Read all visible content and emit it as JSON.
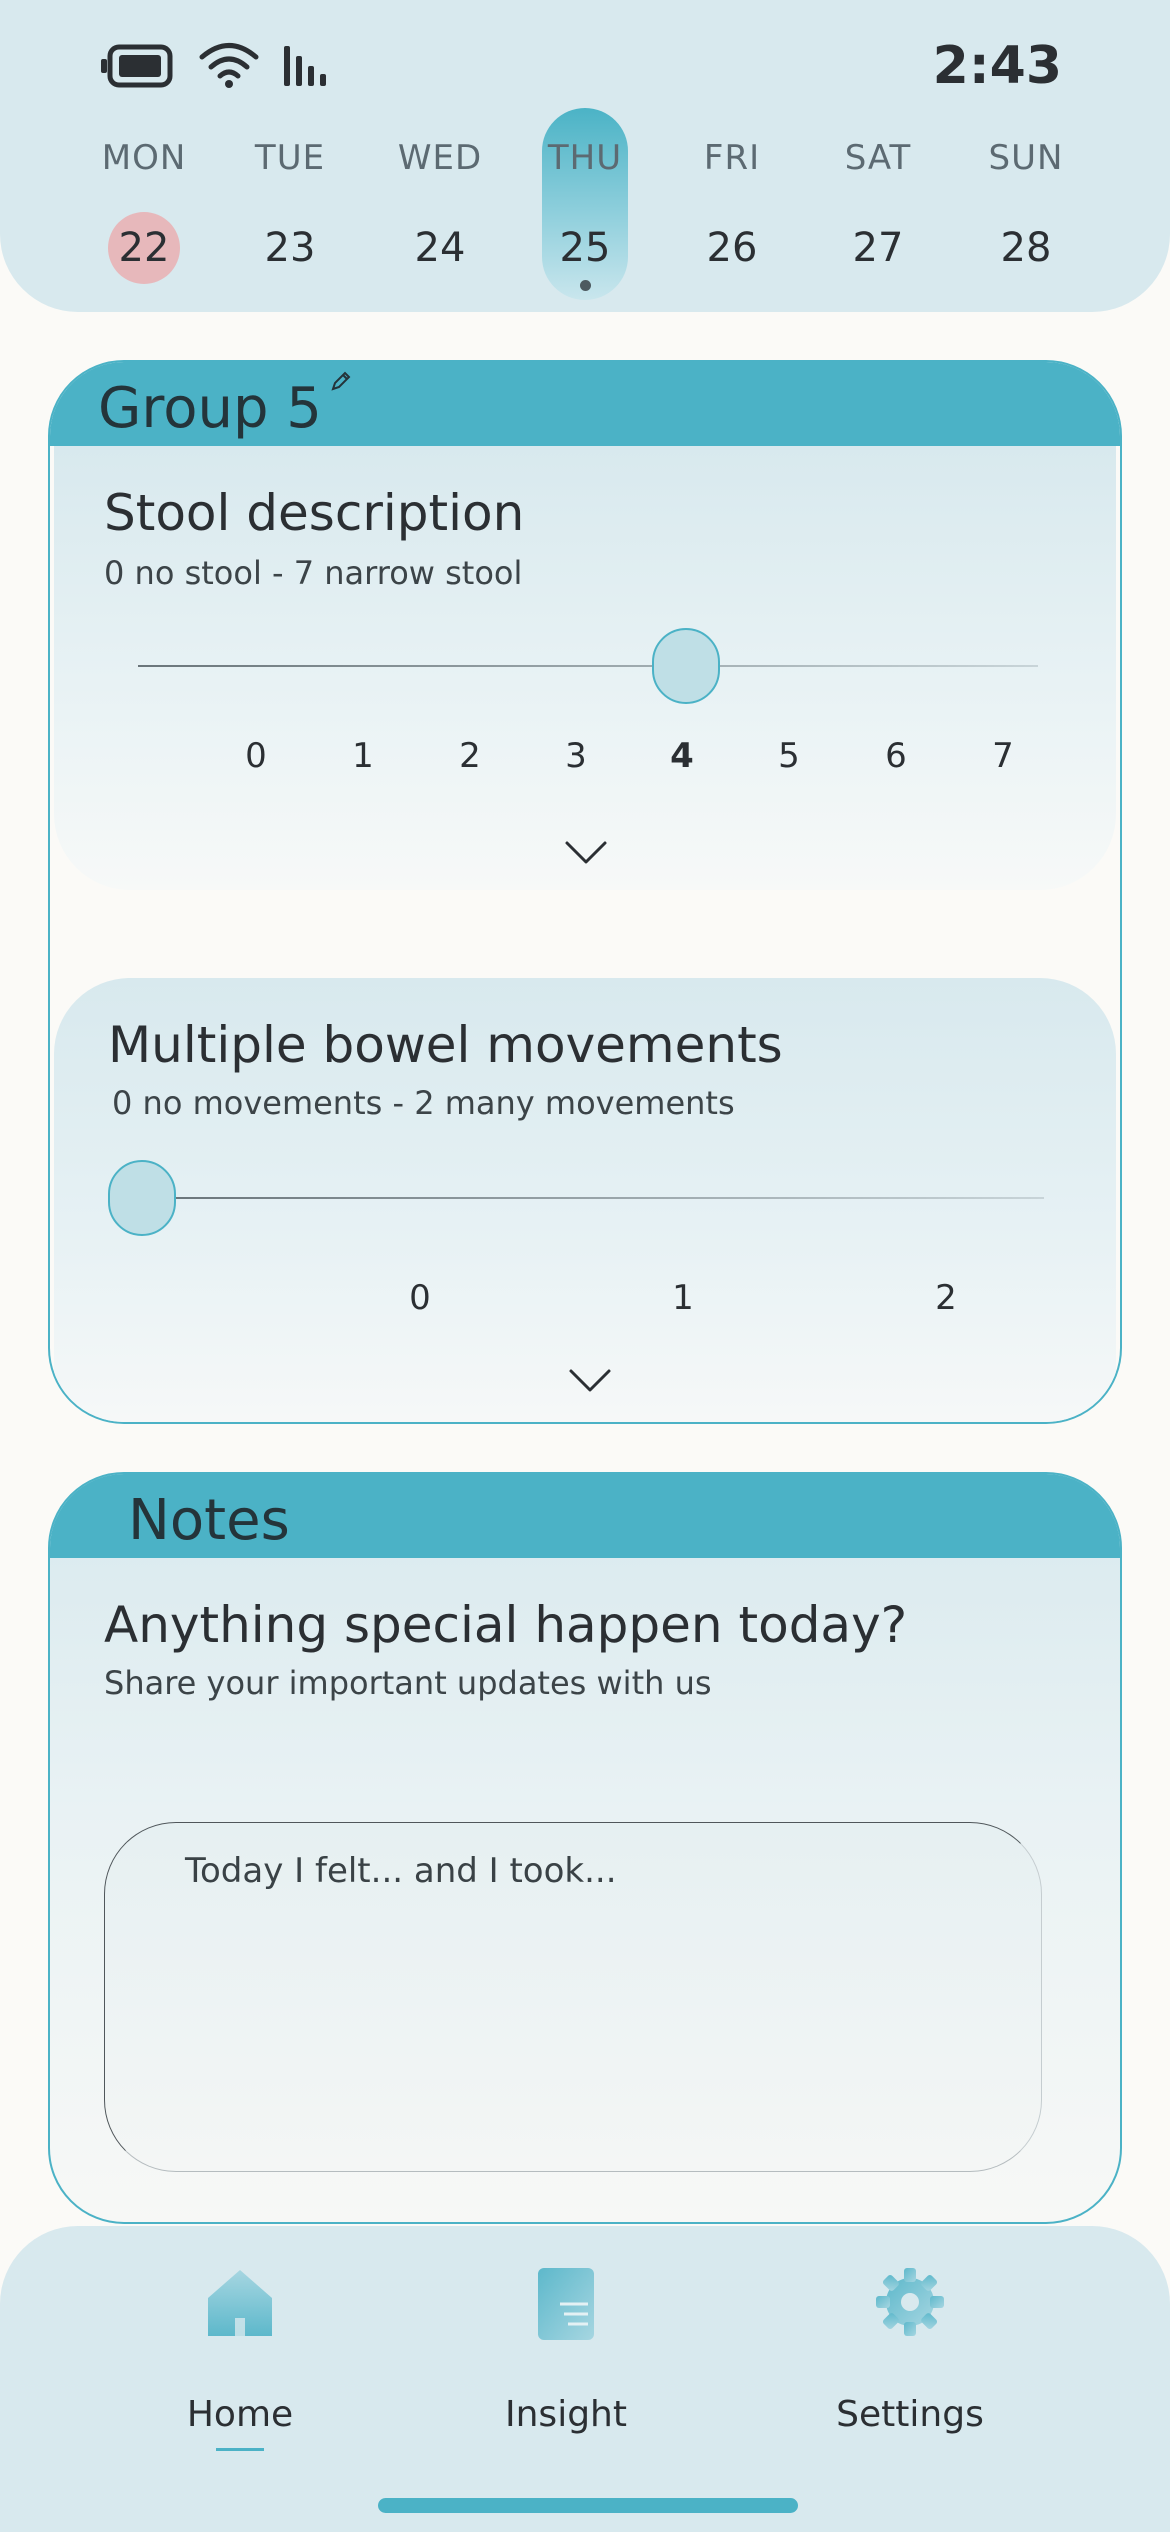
{
  "status_bar": {
    "time": "2:43",
    "icons": [
      "battery-icon",
      "wifi-icon",
      "signal-icon"
    ]
  },
  "week": {
    "days": [
      {
        "name": "MON",
        "num": "22"
      },
      {
        "name": "TUE",
        "num": "23"
      },
      {
        "name": "WED",
        "num": "24"
      },
      {
        "name": "THU",
        "num": "25"
      },
      {
        "name": "FRI",
        "num": "26"
      },
      {
        "name": "SAT",
        "num": "27"
      },
      {
        "name": "SUN",
        "num": "28"
      }
    ],
    "today": "MON",
    "selected": "THU"
  },
  "group": {
    "title": "Group 5",
    "stool": {
      "title": "Stool description",
      "subtitle": "0 no stool - 7 narrow stool",
      "ticks": [
        "0",
        "1",
        "2",
        "3",
        "4",
        "5",
        "6",
        "7"
      ],
      "value": 4
    },
    "bowel": {
      "title": "Multiple bowel movements",
      "subtitle": "0 no movements - 2 many movements",
      "ticks": [
        "0",
        "1",
        "2"
      ],
      "value": 0
    }
  },
  "notes": {
    "title": "Notes",
    "question": "Anything special happen today?",
    "subtitle": "Share your important updates with us",
    "placeholder": "Today I felt... and I took..."
  },
  "nav": {
    "items": [
      {
        "label": "Home",
        "icon": "home-icon",
        "active": true
      },
      {
        "label": "Insight",
        "icon": "insight-icon",
        "active": false
      },
      {
        "label": "Settings",
        "icon": "settings-icon",
        "active": false
      }
    ]
  },
  "colors": {
    "accent": "#4bb2c6",
    "header_bg": "#d8e9ee",
    "today_highlight": "#e7b8bb"
  }
}
